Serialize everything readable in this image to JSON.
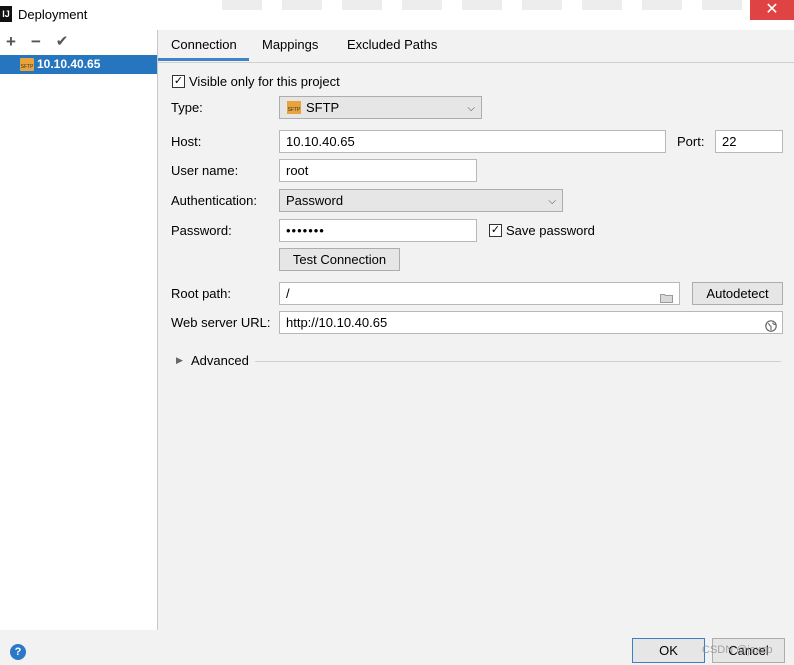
{
  "window": {
    "logo": "IJ",
    "title": "Deployment",
    "close_glyph": "✕"
  },
  "toolbar": {
    "add": "+",
    "remove": "−",
    "apply": "✔"
  },
  "servers": [
    {
      "name": "10.10.40.65",
      "icon": "sftp-server-icon",
      "icon_text": "SFTP",
      "selected": true
    }
  ],
  "tabs": [
    {
      "label": "Connection",
      "active": true
    },
    {
      "label": "Mappings",
      "active": false
    },
    {
      "label": "Excluded Paths",
      "active": false
    }
  ],
  "form": {
    "visible_only": {
      "label": "Visible only for this project",
      "checked": true,
      "mark": "✓"
    },
    "type": {
      "label": "Type:",
      "value": "SFTP",
      "icon_text": "SFTP"
    },
    "host": {
      "label": "Host:",
      "value": "10.10.40.65"
    },
    "port": {
      "label": "Port:",
      "value": "22"
    },
    "username": {
      "label": "User name:",
      "value": "root"
    },
    "authentication": {
      "label": "Authentication:",
      "value": "Password"
    },
    "password": {
      "label": "Password:",
      "value": "•••••••"
    },
    "save_password": {
      "label": "Save password",
      "checked": true,
      "mark": "✓"
    },
    "test_connection": "Test Connection",
    "root_path": {
      "label": "Root path:",
      "value": "/"
    },
    "autodetect": "Autodetect",
    "web_server_url": {
      "label": "Web server URL:",
      "value": "http://10.10.40.65"
    },
    "advanced": "Advanced"
  },
  "footer": {
    "help": "?",
    "ok": "OK",
    "cancel": "Cancel",
    "watermark": "CSDN @jsxzp"
  },
  "colors": {
    "selection": "#2675bf",
    "tab_accent": "#4083c9",
    "close": "#e04343"
  }
}
